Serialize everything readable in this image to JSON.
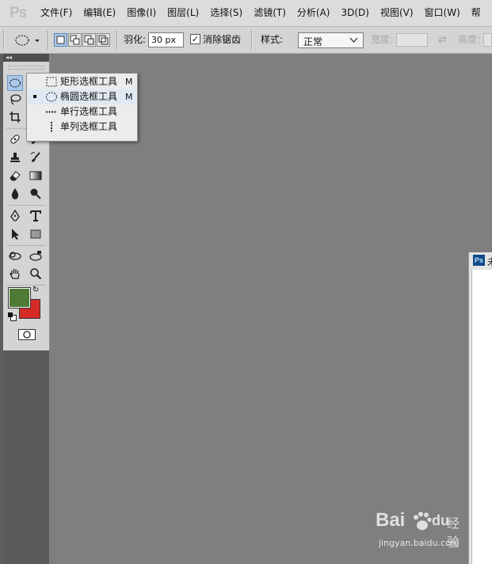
{
  "app": {
    "logo": "Ps"
  },
  "menubar": {
    "items": [
      "文件(F)",
      "编辑(E)",
      "图像(I)",
      "图层(L)",
      "选择(S)",
      "滤镜(T)",
      "分析(A)",
      "3D(D)",
      "视图(V)",
      "窗口(W)",
      "帮"
    ]
  },
  "options": {
    "feather_label": "羽化:",
    "feather_value": "30 px",
    "antialias_label": "消除锯齿",
    "antialias_checked": true,
    "style_label": "样式:",
    "style_value": "正常",
    "width_label": "宽度:",
    "height_label": "高度:"
  },
  "toolbox": {
    "collapse_glyph": "◂◂",
    "active_tool": "ellipse-marquee-icon",
    "foreground_color": "#4e7a35",
    "background_color": "#d52a25"
  },
  "flyout": {
    "items": [
      {
        "label": "矩形选框工具",
        "key": "M",
        "selected": false
      },
      {
        "label": "椭圆选框工具",
        "key": "M",
        "selected": true
      },
      {
        "label": "单行选框工具",
        "key": "",
        "selected": false
      },
      {
        "label": "单列选框工具",
        "key": "",
        "selected": false
      }
    ]
  },
  "document": {
    "title_initial": "未"
  },
  "watermark": {
    "brand_left": "Bai",
    "brand_right": "du",
    "jingyan": "经验",
    "url": "jingyan.baidu.com"
  }
}
